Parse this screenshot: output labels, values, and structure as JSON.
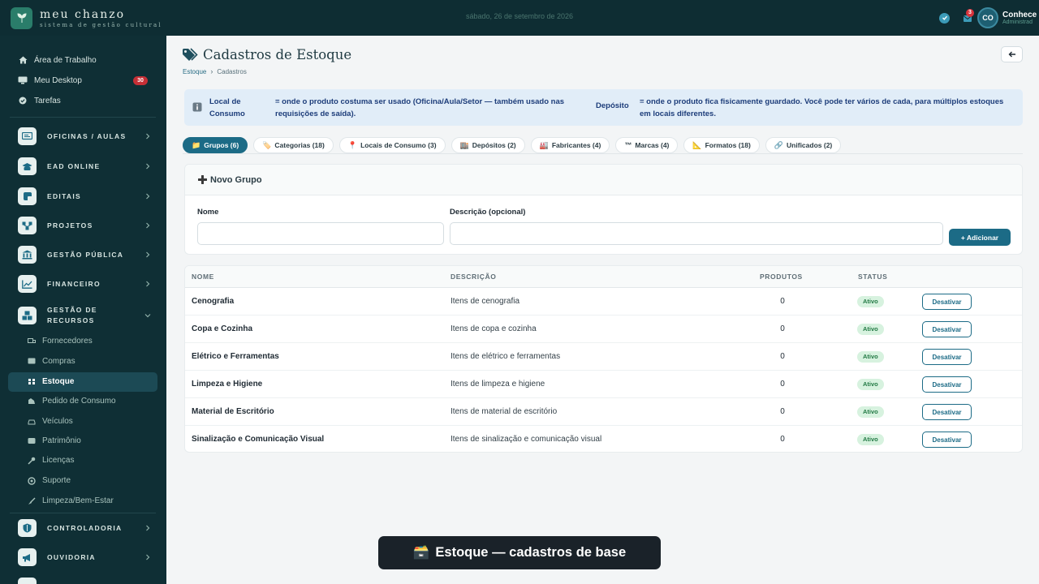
{
  "brand": {
    "name": "meu chanzo",
    "subtitle": "sistema de gestão cultural"
  },
  "topbar": {
    "date": "sábado, 26 de setembro de 2026",
    "mail_count": "3",
    "avatar_initials": "CO",
    "user_name": "Conhece",
    "user_role": "Administrad"
  },
  "sidebar": {
    "top_links": [
      {
        "label": "Área de Trabalho",
        "icon": "home-icon"
      },
      {
        "label": "Meu Desktop",
        "icon": "monitor-icon",
        "badge": "30"
      },
      {
        "label": "Tarefas",
        "icon": "check-circle-icon"
      }
    ],
    "sections": [
      {
        "label": "OFICINAS / AULAS",
        "icon": "blackboard-icon"
      },
      {
        "label": "EAD ONLINE",
        "icon": "graduation-icon"
      },
      {
        "label": "EDITAIS",
        "icon": "document-icon"
      },
      {
        "label": "PROJETOS",
        "icon": "network-icon"
      },
      {
        "label": "GESTÃO PÚBLICA",
        "icon": "building-icon"
      },
      {
        "label": "FINANCEIRO",
        "icon": "chart-icon"
      },
      {
        "label": "GESTÃO DE RECURSOS",
        "icon": "boxes-icon"
      },
      {
        "label": "CONTROLADORIA",
        "icon": "shield-icon"
      },
      {
        "label": "OUVIDORIA",
        "icon": "megaphone-icon"
      }
    ],
    "sub_items": [
      {
        "label": "Fornecedores",
        "icon": "truck-icon"
      },
      {
        "label": "Compras",
        "icon": "cart-icon"
      },
      {
        "label": "Estoque",
        "icon": "warehouse-icon",
        "active": true
      },
      {
        "label": "Pedido de Consumo",
        "icon": "hand-icon"
      },
      {
        "label": "Veículos",
        "icon": "car-icon"
      },
      {
        "label": "Patrimônio",
        "icon": "tag-icon"
      },
      {
        "label": "Licenças",
        "icon": "key-icon"
      },
      {
        "label": "Suporte",
        "icon": "lifebuoy-icon"
      },
      {
        "label": "Limpeza/Bem-Estar",
        "icon": "broom-icon"
      }
    ]
  },
  "page": {
    "title": "Cadastros de Estoque",
    "breadcrumb": {
      "root": "Estoque",
      "current": "Cadastros"
    }
  },
  "info": {
    "term1": "Local de Consumo",
    "desc1": "= onde o produto costuma ser usado (Oficina/Aula/Setor — também usado nas requisições de saída).",
    "term2": "Depósito",
    "desc2": "= onde o produto fica fisicamente guardado. Você pode ter vários de cada, para múltiplos estoques em locais diferentes."
  },
  "tabs": [
    {
      "icon": "📁",
      "label": "Grupos (6)",
      "active": true
    },
    {
      "icon": "🏷️",
      "label": "Categorias (18)"
    },
    {
      "icon": "📍",
      "label": "Locais de Consumo (3)"
    },
    {
      "icon": "🏬",
      "label": "Depósitos (2)"
    },
    {
      "icon": "🏭",
      "label": "Fabricantes (4)"
    },
    {
      "icon": "™",
      "label": "Marcas (4)"
    },
    {
      "icon": "📐",
      "label": "Formatos (18)"
    },
    {
      "icon": "🔗",
      "label": "Unificados (2)"
    }
  ],
  "form": {
    "title": "Novo Grupo",
    "name_label": "Nome",
    "name_value": "",
    "desc_label": "Descrição (opcional)",
    "desc_value": "",
    "add_label": "+ Adicionar"
  },
  "table": {
    "headers": {
      "name": "NOME",
      "desc": "DESCRIÇÃO",
      "products": "PRODUTOS",
      "status": "STATUS"
    },
    "rows": [
      {
        "name": "Cenografia",
        "desc": "Itens de cenografia",
        "products": "0",
        "status": "Ativo",
        "action": "Desativar"
      },
      {
        "name": "Copa e Cozinha",
        "desc": "Itens de copa e cozinha",
        "products": "0",
        "status": "Ativo",
        "action": "Desativar"
      },
      {
        "name": "Elétrico e Ferramentas",
        "desc": "Itens de elétrico e ferramentas",
        "products": "0",
        "status": "Ativo",
        "action": "Desativar"
      },
      {
        "name": "Limpeza e Higiene",
        "desc": "Itens de limpeza e higiene",
        "products": "0",
        "status": "Ativo",
        "action": "Desativar"
      },
      {
        "name": "Material de Escritório",
        "desc": "Itens de material de escritório",
        "products": "0",
        "status": "Ativo",
        "action": "Desativar"
      },
      {
        "name": "Sinalização e Comunicação Visual",
        "desc": "Itens de sinalização e comunicação visual",
        "products": "0",
        "status": "Ativo",
        "action": "Desativar"
      }
    ]
  },
  "toast": {
    "icon": "🗃️",
    "text": "Estoque — cadastros de base"
  },
  "colors": {
    "sidebar": "#0f2f35",
    "accent": "#1c6b86",
    "active_badge": "#d7f2df",
    "alert": "#c62f36"
  }
}
